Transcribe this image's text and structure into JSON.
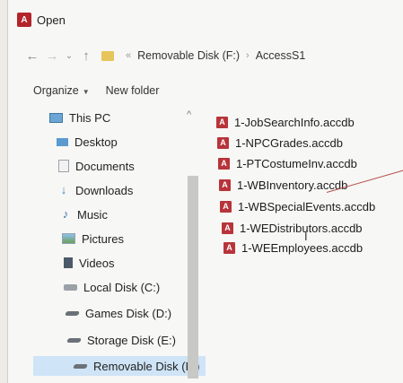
{
  "window": {
    "title": "Open",
    "icon": "access-app-icon"
  },
  "nav": {
    "back_glyph": "←",
    "forward_glyph": "→",
    "history_glyph": "⌄",
    "up_glyph": "↑",
    "overflow_glyph": "«",
    "path": [
      "Removable Disk (F:)",
      "AccessS1"
    ],
    "separator": "›"
  },
  "toolbar": {
    "organize_label": "Organize",
    "organize_caret": "▼",
    "new_folder_label": "New folder"
  },
  "sidebar": {
    "collapse_glyph": "^",
    "items": [
      {
        "label": "This PC",
        "icon": "pc-icon"
      },
      {
        "label": "Desktop",
        "icon": "desktop-icon"
      },
      {
        "label": "Documents",
        "icon": "documents-icon"
      },
      {
        "label": "Downloads",
        "icon": "downloads-icon"
      },
      {
        "label": "Music",
        "icon": "music-icon"
      },
      {
        "label": "Pictures",
        "icon": "pictures-icon"
      },
      {
        "label": "Videos",
        "icon": "videos-icon"
      },
      {
        "label": "Local Disk (C:)",
        "icon": "disk-icon"
      },
      {
        "label": "Games Disk (D:)",
        "icon": "drive-icon"
      },
      {
        "label": "Storage Disk (E:)",
        "icon": "drive-icon"
      },
      {
        "label": "Removable Disk (F:)",
        "icon": "drive-icon",
        "selected": true
      }
    ]
  },
  "files": [
    {
      "name": "1-JobSearchInfo.accdb",
      "icon": "access-file-icon"
    },
    {
      "name": "1-NPCGrades.accdb",
      "icon": "access-file-icon"
    },
    {
      "name": "1-PTCostumeInv.accdb",
      "icon": "access-file-icon"
    },
    {
      "name": "1-WBInventory.accdb",
      "icon": "access-file-icon"
    },
    {
      "name": "1-WBSpecialEvents.accdb",
      "icon": "access-file-icon"
    },
    {
      "name": "1-WEDistributors.accdb",
      "icon": "access-file-icon"
    },
    {
      "name": "1-WEEmployees.accdb",
      "icon": "access-file-icon"
    }
  ],
  "access_badge": "A",
  "colors": {
    "selection": "#cfe4f6",
    "access_red": "#b8343a",
    "folder": "#e8c55a"
  }
}
